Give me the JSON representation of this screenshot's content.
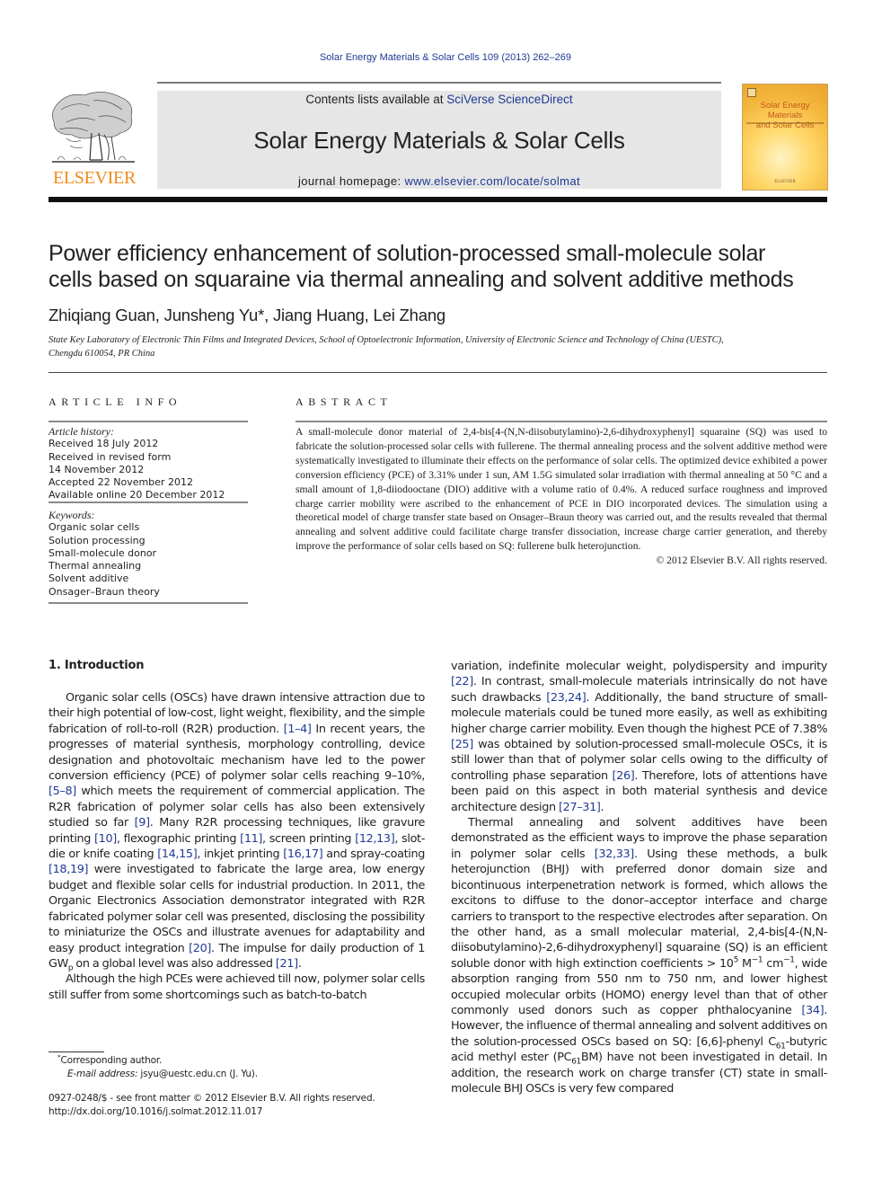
{
  "running_head": "Solar Energy Materials & Solar Cells 109 (2013) 262–269",
  "masthead": {
    "contents_prefix": "Contents lists available at ",
    "contents_link": "SciVerse ScienceDirect",
    "journal_title": "Solar Energy Materials & Solar Cells",
    "homepage_prefix": "journal homepage: ",
    "homepage_link": "www.elsevier.com/locate/solmat",
    "publisher_logo_text": "ELSEVIER",
    "cover_title_line1": "Solar Energy Materials",
    "cover_title_line2": "and Solar Cells",
    "cover_publisher": "ELSEVIER"
  },
  "colors": {
    "link": "#1f3a93",
    "elsevier_orange": "#f28a1c",
    "masthead_bg": "#e6e6e6"
  },
  "article": {
    "title_line1": "Power efficiency enhancement of solution-processed small-molecule solar",
    "title_line2": "cells based on squaraine via thermal annealing and solvent additive methods",
    "authors": "Zhiqiang Guan, Junsheng Yu*, Jiang Huang, Lei Zhang",
    "affiliation_line1": "State Key Laboratory of Electronic Thin Films and Integrated Devices, School of Optoelectronic Information, University of Electronic Science and Technology of China (UESTC),",
    "affiliation_line2": "Chengdu 610054, PR China"
  },
  "article_info": {
    "heading": "ARTICLE INFO",
    "history_label": "Article history:",
    "history": [
      "Received 18 July 2012",
      "Received in revised form",
      "14 November 2012",
      "Accepted 22 November 2012",
      "Available online 20 December 2012"
    ],
    "keywords_label": "Keywords:",
    "keywords": [
      "Organic solar cells",
      "Solution processing",
      "Small-molecule donor",
      "Thermal annealing",
      "Solvent additive",
      "Onsager–Braun theory"
    ]
  },
  "abstract": {
    "heading": "ABSTRACT",
    "text": "A small-molecule donor material of 2,4-bis[4-(N,N-diisobutylamino)-2,6-dihydroxyphenyl] squaraine (SQ) was used to fabricate the solution-processed solar cells with fullerene. The thermal annealing process and the solvent additive method were systematically investigated to illuminate their effects on the performance of solar cells. The optimized device exhibited a power conversion efficiency (PCE) of 3.31% under 1 sun, AM 1.5G simulated solar irradiation with thermal annealing at 50 °C and a small amount of 1,8-diiodooctane (DIO) additive with a volume ratio of 0.4%. A reduced surface roughness and improved charge carrier mobility were ascribed to the enhancement of PCE in DIO incorporated devices. The simulation using a theoretical model of charge transfer state based on Onsager–Braun theory was carried out, and the results revealed that thermal annealing and solvent additive could facilitate charge transfer dissociation, increase charge carrier generation, and thereby improve the performance of solar cells based on SQ: fullerene bulk heterojunction.",
    "copyright": "© 2012 Elsevier B.V. All rights reserved."
  },
  "body": {
    "section_heading": "1.  Introduction",
    "left_paragraphs": [
      [
        {
          "t": "Organic solar cells (OSCs) have drawn intensive attraction due to their high potential of low-cost, light weight, flexibility, and the simple fabrication of roll-to-roll (R2R) production. "
        },
        {
          "r": "[1–4]"
        },
        {
          "t": " In recent years, the progresses of material synthesis, morphology controlling, device designation and photovoltaic mechanism have led to the power conversion efficiency (PCE) of polymer solar cells reaching 9–10%, "
        },
        {
          "r": "[5–8]"
        },
        {
          "t": " which meets the requirement of commercial application. The R2R fabrication of polymer solar cells has also been extensively studied so far "
        },
        {
          "r": "[9]"
        },
        {
          "t": ". Many R2R processing techniques, like gravure printing "
        },
        {
          "r": "[10]"
        },
        {
          "t": ", flexographic printing "
        },
        {
          "r": "[11]"
        },
        {
          "t": ", screen printing "
        },
        {
          "r": "[12,13]"
        },
        {
          "t": ", slot-die or knife coating "
        },
        {
          "r": "[14,15]"
        },
        {
          "t": ", inkjet printing "
        },
        {
          "r": "[16,17]"
        },
        {
          "t": " and spray-coating "
        },
        {
          "r": "[18,19]"
        },
        {
          "t": " were investigated to fabricate the large area, low energy budget and flexible solar cells for industrial production. In 2011, the Organic Electronics Association demonstrator integrated with R2R fabricated polymer solar cell was presented, disclosing the possibility to miniaturize the OSCs and illustrate avenues for adaptability and easy product integration "
        },
        {
          "r": "[20]"
        },
        {
          "t": ". The impulse for daily production of 1 GW"
        },
        {
          "sub": "p"
        },
        {
          "t": " on a global level was also addressed "
        },
        {
          "r": "[21]"
        },
        {
          "t": "."
        }
      ],
      [
        {
          "t": "Although the high PCEs were achieved till now, polymer solar cells still suffer from some shortcomings such as batch-to-batch"
        }
      ]
    ],
    "right_paragraphs": [
      [
        {
          "t": "variation, indefinite molecular weight, polydispersity and impurity "
        },
        {
          "r": "[22]"
        },
        {
          "t": ". In contrast, small-molecule materials intrinsically do not have such drawbacks "
        },
        {
          "r": "[23,24]"
        },
        {
          "t": ". Additionally, the band structure of small-molecule materials could be tuned more easily, as well as exhibiting higher charge carrier mobility. Even though the highest PCE of 7.38% "
        },
        {
          "r": "[25]"
        },
        {
          "t": " was obtained by solution-processed small-molecule OSCs, it is still lower than that of polymer solar cells owing to the difficulty of controlling phase separation "
        },
        {
          "r": "[26]"
        },
        {
          "t": ". Therefore, lots of attentions have been paid on this aspect in both material synthesis and device architecture design "
        },
        {
          "r": "[27–31]"
        },
        {
          "t": "."
        }
      ],
      [
        {
          "t": "Thermal annealing and solvent additives have been demonstrated as the efficient ways to improve the phase separation in polymer solar cells "
        },
        {
          "r": "[32,33]"
        },
        {
          "t": ". Using these methods, a bulk heterojunction (BHJ) with preferred donor domain size and bicontinuous interpenetration network is formed, which allows the excitons to diffuse to the donor–acceptor interface and charge carriers to transport to the respective electrodes after separation. On the other hand, as a small molecular material, 2,4-bis[4-(N,N-diisobutylamino)-2,6-dihydroxyphenyl] squaraine (SQ) is an efficient soluble donor with high extinction coefficients > 10"
        },
        {
          "sup": "5"
        },
        {
          "t": " M"
        },
        {
          "sup": "−1"
        },
        {
          "t": " cm"
        },
        {
          "sup": "−1"
        },
        {
          "t": ", wide absorption ranging from 550 nm to 750 nm, and lower highest occupied molecular orbits (HOMO) energy level than that of other commonly used donors such as copper phthalocyanine "
        },
        {
          "r": "[34]"
        },
        {
          "t": ". However, the influence of thermal annealing and solvent additives on the solution-processed OSCs based on SQ: [6,6]-phenyl C"
        },
        {
          "sub": "61"
        },
        {
          "t": "-butyric acid methyl ester (PC"
        },
        {
          "sub": "61"
        },
        {
          "t": "BM) have not been investigated in detail. In addition, the research work on charge transfer (CT) state in small-molecule BHJ OSCs is very few compared"
        }
      ]
    ]
  },
  "footnotes": {
    "corresponding": "Corresponding author.",
    "corresponding_mark": "*",
    "email_label": "E-mail address: ",
    "email_value": "jsyu@uestc.edu.cn (J. Yu).",
    "issn_line": "0927-0248/$ - see front matter © 2012 Elsevier B.V. All rights reserved.",
    "doi_line": "http://dx.doi.org/10.1016/j.solmat.2012.11.017"
  }
}
